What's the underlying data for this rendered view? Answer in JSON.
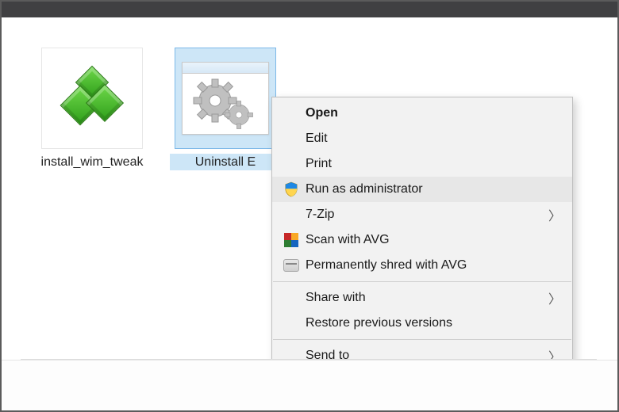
{
  "files": [
    {
      "label": "install_wim_tweak",
      "selected": false,
      "icon": "registry-icon"
    },
    {
      "label": "Uninstall E",
      "selected": true,
      "icon": "batch-file-icon"
    }
  ],
  "context_menu": {
    "groups": [
      [
        {
          "label": "Open",
          "icon": null,
          "default": true,
          "submenu": false,
          "hovered": false
        },
        {
          "label": "Edit",
          "icon": null,
          "default": false,
          "submenu": false,
          "hovered": false
        },
        {
          "label": "Print",
          "icon": null,
          "default": false,
          "submenu": false,
          "hovered": false
        },
        {
          "label": "Run as administrator",
          "icon": "shield-icon",
          "default": false,
          "submenu": false,
          "hovered": true
        },
        {
          "label": "7-Zip",
          "icon": null,
          "default": false,
          "submenu": true,
          "hovered": false
        },
        {
          "label": "Scan with AVG",
          "icon": "avg-icon",
          "default": false,
          "submenu": false,
          "hovered": false
        },
        {
          "label": "Permanently shred with AVG",
          "icon": "shredder-icon",
          "default": false,
          "submenu": false,
          "hovered": false
        }
      ],
      [
        {
          "label": "Share with",
          "icon": null,
          "default": false,
          "submenu": true,
          "hovered": false
        },
        {
          "label": "Restore previous versions",
          "icon": null,
          "default": false,
          "submenu": false,
          "hovered": false
        }
      ],
      [
        {
          "label": "Send to",
          "icon": null,
          "default": false,
          "submenu": true,
          "hovered": false
        }
      ]
    ]
  }
}
